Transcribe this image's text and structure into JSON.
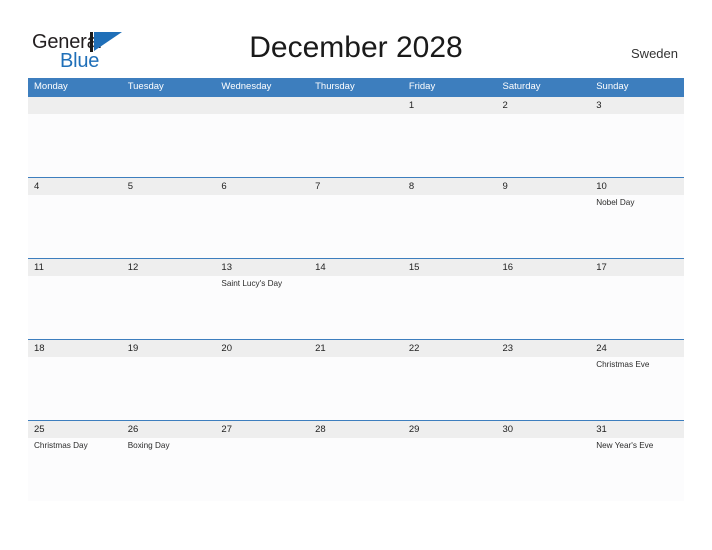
{
  "brand": {
    "name_part1": "General",
    "name_part2": "Blue",
    "mark": "triangle-flag-mark"
  },
  "header": {
    "title": "December 2028",
    "country": "Sweden"
  },
  "colors": {
    "header_blue": "#3d7ebe",
    "band_gray": "#eeeeee",
    "brand_blue": "#1f6fb8",
    "text_dark": "#231f20"
  },
  "calendar": {
    "weekday_headers": [
      "Monday",
      "Tuesday",
      "Wednesday",
      "Thursday",
      "Friday",
      "Saturday",
      "Sunday"
    ],
    "weeks": [
      [
        {
          "day": "",
          "event": ""
        },
        {
          "day": "",
          "event": ""
        },
        {
          "day": "",
          "event": ""
        },
        {
          "day": "",
          "event": ""
        },
        {
          "day": "1",
          "event": ""
        },
        {
          "day": "2",
          "event": ""
        },
        {
          "day": "3",
          "event": ""
        }
      ],
      [
        {
          "day": "4",
          "event": ""
        },
        {
          "day": "5",
          "event": ""
        },
        {
          "day": "6",
          "event": ""
        },
        {
          "day": "7",
          "event": ""
        },
        {
          "day": "8",
          "event": ""
        },
        {
          "day": "9",
          "event": ""
        },
        {
          "day": "10",
          "event": "Nobel Day"
        }
      ],
      [
        {
          "day": "11",
          "event": ""
        },
        {
          "day": "12",
          "event": ""
        },
        {
          "day": "13",
          "event": "Saint Lucy's Day"
        },
        {
          "day": "14",
          "event": ""
        },
        {
          "day": "15",
          "event": ""
        },
        {
          "day": "16",
          "event": ""
        },
        {
          "day": "17",
          "event": ""
        }
      ],
      [
        {
          "day": "18",
          "event": ""
        },
        {
          "day": "19",
          "event": ""
        },
        {
          "day": "20",
          "event": ""
        },
        {
          "day": "21",
          "event": ""
        },
        {
          "day": "22",
          "event": ""
        },
        {
          "day": "23",
          "event": ""
        },
        {
          "day": "24",
          "event": "Christmas Eve"
        }
      ],
      [
        {
          "day": "25",
          "event": "Christmas Day"
        },
        {
          "day": "26",
          "event": "Boxing Day"
        },
        {
          "day": "27",
          "event": ""
        },
        {
          "day": "28",
          "event": ""
        },
        {
          "day": "29",
          "event": ""
        },
        {
          "day": "30",
          "event": ""
        },
        {
          "day": "31",
          "event": "New Year's Eve"
        }
      ]
    ]
  }
}
